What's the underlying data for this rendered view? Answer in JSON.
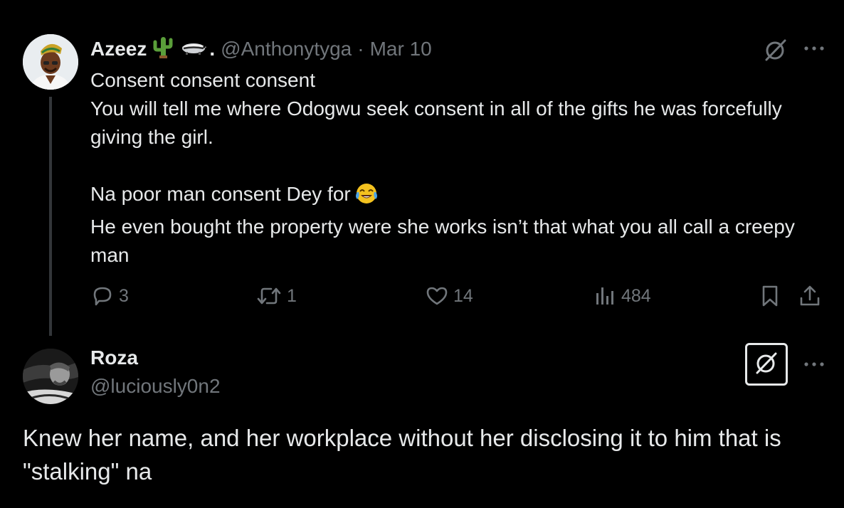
{
  "tweet1": {
    "author_name": "Azeez",
    "name_emojis": [
      "cactus-icon",
      "badger-icon"
    ],
    "name_suffix": ".",
    "handle": "@Anthonytyga",
    "separator": "·",
    "date": "Mar 10",
    "lines": [
      "Consent consent consent",
      "You will tell me where Odogwu seek consent in all of the gifts he was forcefully giving the girl."
    ],
    "line_emoji": "Na poor man consent Dey for",
    "lines_after": [
      "He even bought the property were she works isn’t that what you all call a creepy man"
    ],
    "actions": {
      "replies": "3",
      "retweets": "1",
      "likes": "14",
      "views": "484"
    }
  },
  "tweet2": {
    "author_name": "Roza",
    "handle": "@luciously0n2",
    "body": "Knew her name, and her workplace without her disclosing it to him that is \"stalking\" na"
  },
  "colors": {
    "background": "#000000",
    "text": "#e7e9ea",
    "muted": "#71767b",
    "thread_line": "#333639"
  }
}
